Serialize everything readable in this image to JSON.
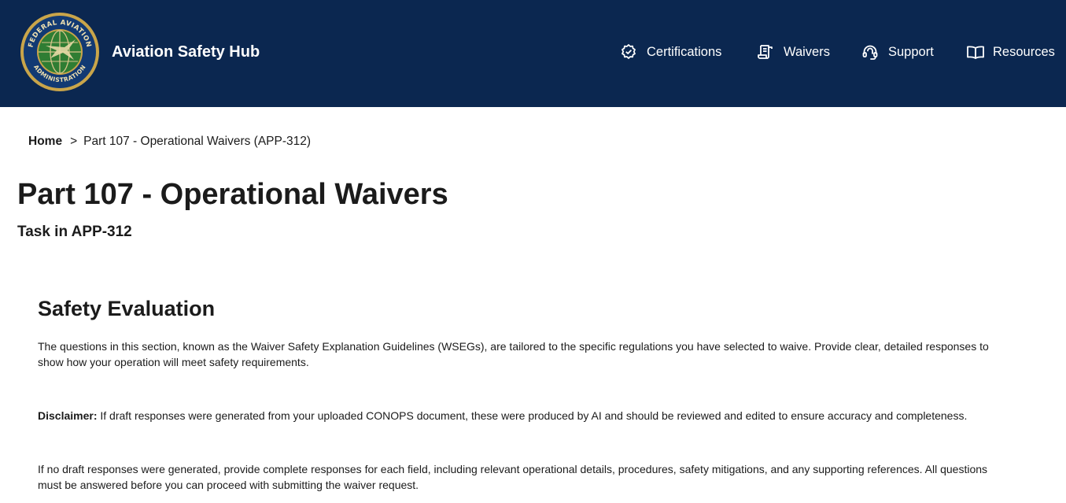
{
  "header": {
    "app_title": "Aviation Safety Hub",
    "logo": {
      "icon": "faa-seal-logo",
      "ring_text_top": "FEDERAL AVIATION",
      "ring_text_bottom": "ADMINISTRATION"
    },
    "nav": [
      {
        "label": "Certifications",
        "icon": "certificate-badge-icon"
      },
      {
        "label": "Waivers",
        "icon": "document-icon"
      },
      {
        "label": "Support",
        "icon": "headset-icon"
      },
      {
        "label": "Resources",
        "icon": "open-book-icon"
      }
    ]
  },
  "breadcrumb": {
    "home": "Home",
    "separator": ">",
    "current": "Part 107 - Operational Waivers (APP-312)"
  },
  "page": {
    "title": "Part 107 - Operational Waivers",
    "subtitle": "Task in APP-312"
  },
  "section": {
    "title": "Safety Evaluation",
    "intro": "The questions in this section, known as the Waiver Safety Explanation Guidelines (WSEGs), are tailored to the specific regulations you have selected to waive. Provide clear, detailed responses to show how your operation will meet safety requirements.",
    "disclaimer_label": "Disclaimer:",
    "disclaimer_text": " If draft responses were generated from your uploaded CONOPS document, these were produced by AI and should be reviewed and edited to ensure accuracy and completeness.",
    "no_draft_text": "If no draft responses were generated, provide complete responses for each field, including relevant operational details, procedures, safety mitigations, and any supporting references. All questions must be answered before you can proceed with submitting the waiver request."
  },
  "colors": {
    "header_bg": "#0b2750",
    "seal_gold": "#c9a54a",
    "seal_navy": "#123a73",
    "globe_green": "#3f8f3a"
  }
}
